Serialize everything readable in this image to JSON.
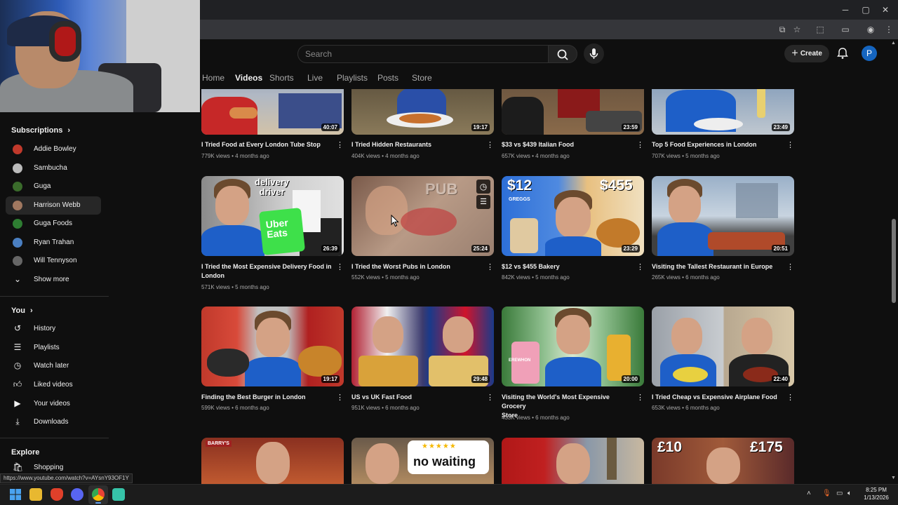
{
  "browser": {
    "window_controls": {
      "minimize": "─",
      "maximize": "▢",
      "close": "✕"
    }
  },
  "header": {
    "search_placeholder": "Search",
    "create_label": "Create",
    "avatar_letter": "P"
  },
  "tabs": [
    "Home",
    "Videos",
    "Shorts",
    "Live",
    "Playlists",
    "Posts",
    "Store"
  ],
  "active_tab": "Videos",
  "sidebar": {
    "subscriptions_heading": "Subscriptions",
    "subscriptions": [
      {
        "label": "Addie Bowley",
        "color": "#c0392b"
      },
      {
        "label": "Sambucha",
        "color": "#bbbbbb"
      },
      {
        "label": "Guga",
        "color": "#3a6b2b"
      },
      {
        "label": "Harrison Webb",
        "color": "#a07860"
      },
      {
        "label": "Guga Foods",
        "color": "#2e7d32"
      },
      {
        "label": "Ryan Trahan",
        "color": "#4a7fc1"
      },
      {
        "label": "Will Tennyson",
        "color": "#666666"
      }
    ],
    "show_more": "Show more",
    "you_heading": "You",
    "you_items": [
      {
        "label": "History",
        "icon": "history-icon"
      },
      {
        "label": "Playlists",
        "icon": "playlists-icon"
      },
      {
        "label": "Watch later",
        "icon": "clock-icon"
      },
      {
        "label": "Liked videos",
        "icon": "thumbs-up-icon"
      },
      {
        "label": "Your videos",
        "icon": "video-icon"
      },
      {
        "label": "Downloads",
        "icon": "download-icon"
      }
    ],
    "explore_heading": "Explore",
    "explore_items": [
      {
        "label": "Shopping",
        "icon": "shopping-bag-icon"
      }
    ]
  },
  "videos": [
    {
      "title": "I Tried Food at Every London Tube Stop",
      "title2": "",
      "views": "779K views",
      "age": "4 months ago",
      "duration": "40:07"
    },
    {
      "title": "I Tried Hidden Restaurants",
      "title2": "",
      "views": "404K views",
      "age": "4 months ago",
      "duration": "19:17"
    },
    {
      "title": "$33 vs $439 Italian Food",
      "title2": "",
      "views": "657K views",
      "age": "4 months ago",
      "duration": "23:59"
    },
    {
      "title": "Top 5 Food Experiences in London",
      "title2": "",
      "views": "707K views",
      "age": "5 months ago",
      "duration": "23:49"
    },
    {
      "title": "I Tried the Most Expensive Delivery Food in",
      "title2": "London",
      "views": "571K views",
      "age": "5 months ago",
      "duration": "26:39",
      "thumb_text": [
        "delivery",
        "driver",
        "Uber",
        "Eats"
      ]
    },
    {
      "title": "I Tried the Worst Pubs in London",
      "title2": "",
      "views": "552K views",
      "age": "5 months ago",
      "duration": "25:24",
      "thumb_text": [
        "PUB"
      ]
    },
    {
      "title": "$12 vs $455 Bakery",
      "title2": "",
      "views": "842K views",
      "age": "5 months ago",
      "duration": "23:29",
      "thumb_text": [
        "$12",
        "$455",
        "GREGGS"
      ]
    },
    {
      "title": "Visiting the Tallest Restaurant in Europe",
      "title2": "",
      "views": "265K views",
      "age": "6 months ago",
      "duration": "20:51"
    },
    {
      "title": "Finding the Best Burger in London",
      "title2": "",
      "views": "599K views",
      "age": "6 months ago",
      "duration": "19:17"
    },
    {
      "title": "US vs UK Fast Food",
      "title2": "",
      "views": "951K views",
      "age": "6 months ago",
      "duration": "29:48"
    },
    {
      "title": "Visiting the World's Most Expensive Grocery",
      "title2": "Store",
      "views": "433K views",
      "age": "6 months ago",
      "duration": "20:00",
      "thumb_text": [
        "EREWHON"
      ]
    },
    {
      "title": "I Tried Cheap vs Expensive Airplane Food",
      "title2": "",
      "views": "653K views",
      "age": "6 months ago",
      "duration": "22:40"
    }
  ],
  "partial_row_text": {
    "no_waiting": "no waiting",
    "price_low": "£10",
    "price_high": "£175",
    "barrys": "BARRY'S"
  },
  "status_url": "https://www.youtube.com/watch?v=AYsnY93OF1Y",
  "clock": {
    "time": "8:25 PM",
    "date": "1/13/2026"
  },
  "colors": {
    "accent": "#1565c0",
    "background": "#0f0f0f"
  }
}
